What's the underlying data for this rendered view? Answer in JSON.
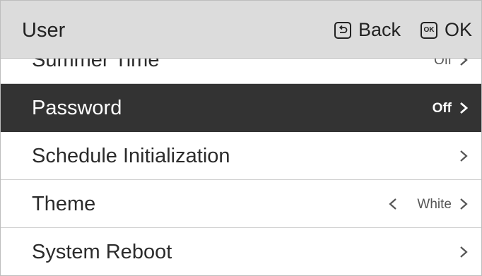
{
  "header": {
    "title": "User",
    "back_label": "Back",
    "ok_icon_text": "OK",
    "ok_label": "OK"
  },
  "menu": {
    "items": [
      {
        "label": "Summer Time",
        "value": "Off"
      },
      {
        "label": "Password",
        "value": "Off",
        "selected": true
      },
      {
        "label": "Schedule Initialization",
        "value": ""
      },
      {
        "label": "Theme",
        "value": "White"
      },
      {
        "label": "System Reboot",
        "value": ""
      }
    ]
  },
  "colors": {
    "header_bg": "#dcdcdc",
    "selected_bg": "#333333",
    "row_bg": "#ffffff",
    "divider": "#cfcfcf"
  },
  "icons": {
    "back": "back-arrow-icon",
    "ok": "ok-icon",
    "next": "chevron-right-icon",
    "prev": "chevron-left-icon"
  }
}
